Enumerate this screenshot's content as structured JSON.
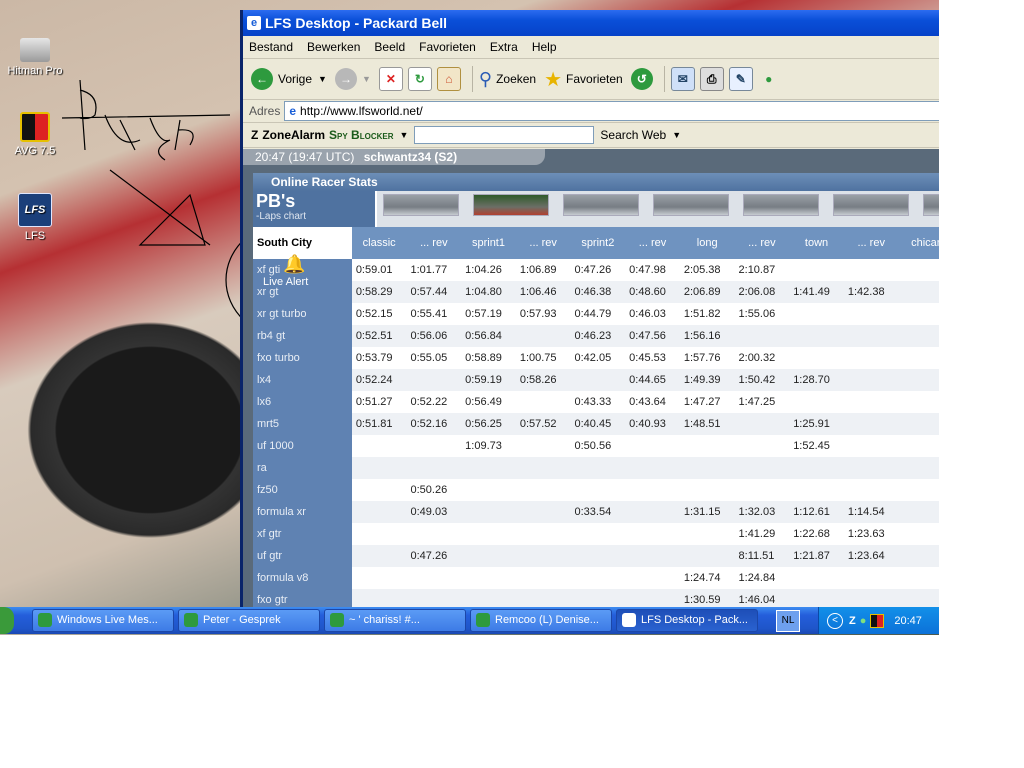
{
  "desktop": {
    "icons": [
      {
        "label": "Hitman Pro"
      },
      {
        "label": "AVG 7.5"
      },
      {
        "label": "LFS"
      }
    ]
  },
  "window": {
    "title": "LFS Desktop - Packard Bell",
    "menu": [
      "Bestand",
      "Bewerken",
      "Beeld",
      "Favorieten",
      "Extra",
      "Help"
    ],
    "toolbar": {
      "back_label": "Vorige",
      "search_label": "Zoeken",
      "favorites_label": "Favorieten"
    },
    "address": {
      "label": "Adres",
      "url": "http://www.lfsworld.net/"
    },
    "zonealarm": {
      "brand": "ZoneAlarm",
      "product": "Spy Blocker",
      "search_button": "Search Web"
    }
  },
  "lfs": {
    "status_time": "20:47 (19:47 UTC)",
    "status_user": "schwantz34 (S2)",
    "panel_title": "Online Racer Stats",
    "pb_title": "PB's",
    "pb_subtitle": "-Laps chart",
    "live_alert": "Live Alert",
    "table": {
      "location": "South City",
      "columns": [
        "classic",
        "... rev",
        "sprint1",
        "... rev",
        "sprint2",
        "... rev",
        "long",
        "... rev",
        "town",
        "... rev",
        "chicar"
      ],
      "rows": [
        {
          "car": "xf gti",
          "times": [
            "0:59.01",
            "1:01.77",
            "1:04.26",
            "1:06.89",
            "0:47.26",
            "0:47.98",
            "2:05.38",
            "2:10.87",
            "",
            "",
            ""
          ]
        },
        {
          "car": "xr gt",
          "times": [
            "0:58.29",
            "0:57.44",
            "1:04.80",
            "1:06.46",
            "0:46.38",
            "0:48.60",
            "2:06.89",
            "2:06.08",
            "1:41.49",
            "1:42.38",
            ""
          ]
        },
        {
          "car": "xr gt turbo",
          "times": [
            "0:52.15",
            "0:55.41",
            "0:57.19",
            "0:57.93",
            "0:44.79",
            "0:46.03",
            "1:51.82",
            "1:55.06",
            "",
            "",
            ""
          ]
        },
        {
          "car": "rb4 gt",
          "times": [
            "0:52.51",
            "0:56.06",
            "0:56.84",
            "",
            "0:46.23",
            "0:47.56",
            "1:56.16",
            "",
            "",
            "",
            ""
          ]
        },
        {
          "car": "fxo turbo",
          "times": [
            "0:53.79",
            "0:55.05",
            "0:58.89",
            "1:00.75",
            "0:42.05",
            "0:45.53",
            "1:57.76",
            "2:00.32",
            "",
            "",
            ""
          ]
        },
        {
          "car": "lx4",
          "times": [
            "0:52.24",
            "",
            "0:59.19",
            "0:58.26",
            "",
            "0:44.65",
            "1:49.39",
            "1:50.42",
            "1:28.70",
            "",
            ""
          ]
        },
        {
          "car": "lx6",
          "times": [
            "0:51.27",
            "0:52.22",
            "0:56.49",
            "",
            "0:43.33",
            "0:43.64",
            "1:47.27",
            "1:47.25",
            "",
            "",
            ""
          ]
        },
        {
          "car": "mrt5",
          "times": [
            "0:51.81",
            "0:52.16",
            "0:56.25",
            "0:57.52",
            "0:40.45",
            "0:40.93",
            "1:48.51",
            "",
            "1:25.91",
            "",
            ""
          ]
        },
        {
          "car": "uf 1000",
          "times": [
            "",
            "",
            "1:09.73",
            "",
            "0:50.56",
            "",
            "",
            "",
            "1:52.45",
            "",
            ""
          ]
        },
        {
          "car": "ra",
          "times": [
            "",
            "",
            "",
            "",
            "",
            "",
            "",
            "",
            "",
            "",
            ""
          ]
        },
        {
          "car": "fz50",
          "times": [
            "",
            "0:50.26",
            "",
            "",
            "",
            "",
            "",
            "",
            "",
            "",
            ""
          ]
        },
        {
          "car": "formula xr",
          "times": [
            "",
            "0:49.03",
            "",
            "",
            "0:33.54",
            "",
            "1:31.15",
            "1:32.03",
            "1:12.61",
            "1:14.54",
            ""
          ]
        },
        {
          "car": "xf gtr",
          "times": [
            "",
            "",
            "",
            "",
            "",
            "",
            "",
            "1:41.29",
            "1:22.68",
            "1:23.63",
            ""
          ]
        },
        {
          "car": "uf gtr",
          "times": [
            "",
            "0:47.26",
            "",
            "",
            "",
            "",
            "",
            "8:11.51",
            "1:21.87",
            "1:23.64",
            ""
          ]
        },
        {
          "car": "formula v8",
          "times": [
            "",
            "",
            "",
            "",
            "",
            "",
            "1:24.74",
            "1:24.84",
            "",
            "",
            ""
          ]
        },
        {
          "car": "fxo gtr",
          "times": [
            "",
            "",
            "",
            "",
            "",
            "",
            "1:30.59",
            "1:46.04",
            "",
            "",
            ""
          ]
        }
      ]
    }
  },
  "taskbar": {
    "buttons": [
      {
        "label": "Windows Live Mes...",
        "color": "#2e9a3e"
      },
      {
        "label": "Peter - Gesprek",
        "color": "#2e9a3e"
      },
      {
        "label": "~ '   chariss!     #...",
        "color": "#2e9a3e"
      },
      {
        "label": "Remcoo (L) Denise...",
        "color": "#2e9a3e"
      },
      {
        "label": "LFS Desktop - Pack...",
        "color": "#ffffff"
      }
    ],
    "language": "NL",
    "clock": "20:47"
  }
}
